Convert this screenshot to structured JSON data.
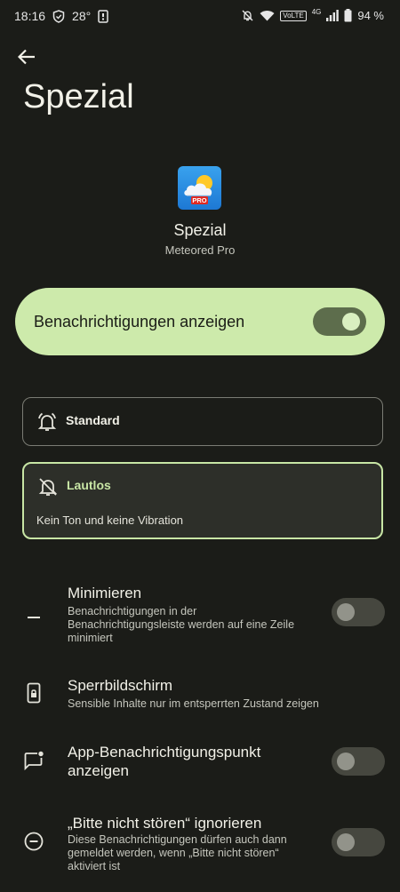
{
  "status_bar": {
    "time": "18:16",
    "temp": "28°",
    "network": "4G",
    "volte": "VoLTE",
    "battery": "94 %"
  },
  "header": {
    "title": "Spezial"
  },
  "app": {
    "name": "Spezial",
    "subtitle": "Meteored Pro",
    "icon_badge": "PRO"
  },
  "main_toggle": {
    "label": "Benachrichtigungen anzeigen",
    "state": true
  },
  "options": [
    {
      "label": "Standard",
      "selected": false
    },
    {
      "label": "Lautlos",
      "description": "Kein Ton und keine Vibration",
      "selected": true
    }
  ],
  "settings": [
    {
      "title": "Minimieren",
      "description": "Benachrichtigungen in der Benachrichtigungsleiste werden auf eine Zeile minimiert",
      "toggle": false
    },
    {
      "title": "Sperrbildschirm",
      "description": "Sensible Inhalte nur im entsperrten Zustand zeigen"
    },
    {
      "title": "App-Benachrichtigungspunkt anzeigen",
      "toggle": false
    },
    {
      "title": "„Bitte nicht stören“ ignorieren",
      "description": "Diese Benachrichtigungen dürfen auch dann gemeldet werden, wenn „Bitte nicht stören“ aktiviert ist",
      "toggle": false
    }
  ],
  "colors": {
    "background": "#1b1c18",
    "accent": "#cdeaab",
    "accent_border": "#c8e6a5"
  }
}
